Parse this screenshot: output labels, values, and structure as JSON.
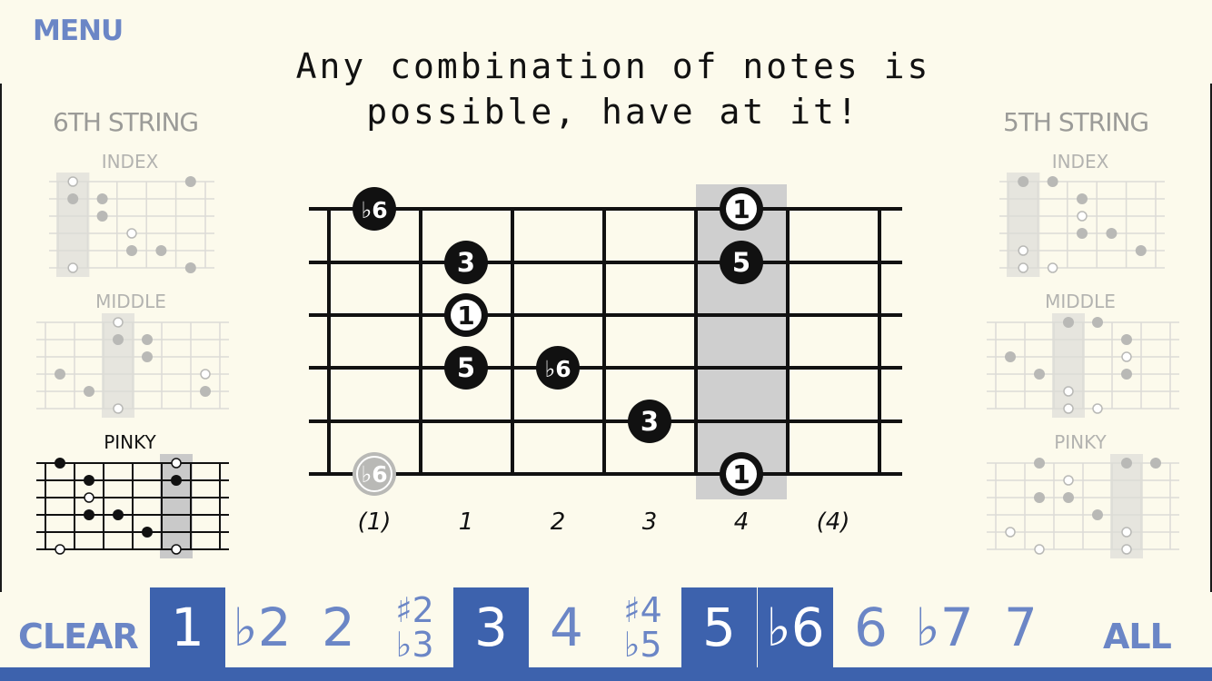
{
  "menu_label": "MENU",
  "title_line1": "Any combination of notes is",
  "title_line2": "possible, have at it!",
  "left_panel": {
    "title": "6TH STRING",
    "patterns": [
      {
        "label": "INDEX",
        "active": false
      },
      {
        "label": "MIDDLE",
        "active": false
      },
      {
        "label": "PINKY",
        "active": true
      }
    ]
  },
  "right_panel": {
    "title": "5TH STRING",
    "patterns": [
      {
        "label": "INDEX",
        "active": false
      },
      {
        "label": "MIDDLE",
        "active": false
      },
      {
        "label": "PINKY",
        "active": false
      }
    ]
  },
  "fretboard": {
    "fret_labels": [
      "(1)",
      "1",
      "2",
      "3",
      "4",
      "(4)"
    ],
    "notes": [
      {
        "string": 1,
        "fret": 0,
        "label": "♭6",
        "style": "filled"
      },
      {
        "string": 1,
        "fret": 4,
        "label": "1",
        "style": "root"
      },
      {
        "string": 2,
        "fret": 1,
        "label": "3",
        "style": "filled"
      },
      {
        "string": 2,
        "fret": 4,
        "label": "5",
        "style": "filled"
      },
      {
        "string": 3,
        "fret": 1,
        "label": "1",
        "style": "root"
      },
      {
        "string": 4,
        "fret": 1,
        "label": "5",
        "style": "filled"
      },
      {
        "string": 4,
        "fret": 2,
        "label": "♭6",
        "style": "filled"
      },
      {
        "string": 5,
        "fret": 3,
        "label": "3",
        "style": "filled"
      },
      {
        "string": 6,
        "fret": 0,
        "label": "♭6",
        "style": "ghost"
      },
      {
        "string": 6,
        "fret": 4,
        "label": "1",
        "style": "root"
      }
    ],
    "highlight_fret": 4
  },
  "bottom_bar": {
    "clear_label": "CLEAR",
    "all_label": "ALL",
    "keys": [
      {
        "label": "1",
        "on": true
      },
      {
        "label": "♭2",
        "on": false
      },
      {
        "label": "2",
        "on": false
      },
      {
        "top": "♯2",
        "bottom": "♭3",
        "on": false
      },
      {
        "label": "3",
        "on": true
      },
      {
        "label": "4",
        "on": false
      },
      {
        "top": "♯4",
        "bottom": "♭5",
        "on": false
      },
      {
        "label": "5",
        "on": true
      },
      {
        "label": "♭6",
        "on": true
      },
      {
        "label": "6",
        "on": false
      },
      {
        "label": "♭7",
        "on": false
      },
      {
        "label": "7",
        "on": false
      }
    ]
  },
  "colors": {
    "background": "#fcfaec",
    "accent": "#3d62ad",
    "accent_light": "#6b86c6",
    "highlight_fret": "#cfcfcf"
  }
}
